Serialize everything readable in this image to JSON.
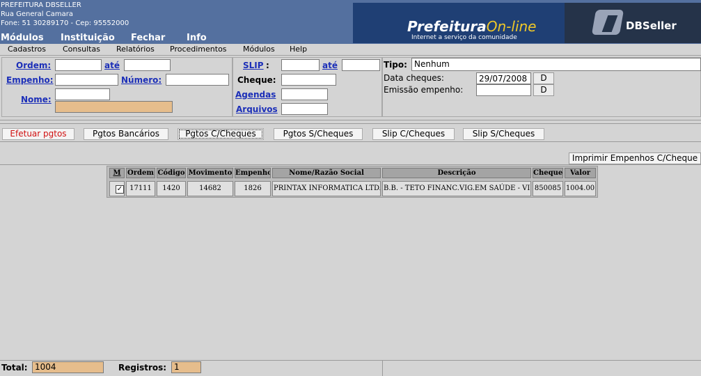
{
  "header": {
    "org_name": "PREFEITURA DBSELLER",
    "address": "Rua General Camara",
    "contact": "Fone: 51 30289170  -  Cep: 95552000",
    "top_menu": [
      "Módulos",
      "Instituição",
      "Fechar",
      "Info"
    ],
    "banner": {
      "logo_main": "Prefeitura",
      "logo_accent": "On-line",
      "tagline": "Internet a serviço da comunidade",
      "brand": "DBSeller"
    }
  },
  "menubar": [
    "Cadastros",
    "Consultas",
    "Relatórios",
    "Procedimentos",
    "Módulos",
    "Help"
  ],
  "filters": {
    "ordem_label": "Ordem:",
    "ate_label": "até",
    "empenho_label": "Empenho:",
    "numero_label": "Número:",
    "nome_label": "Nome:",
    "slip_label": "SLIP",
    "slip_colon": ":",
    "slip_ate_label": "até",
    "cheque_label": "Cheque:",
    "agendas_label": "Agendas",
    "arquivos_label": "Arquivos",
    "tipo_label": "Tipo:",
    "tipo_value": "Nenhum",
    "data_cheques_label": "Data cheques:",
    "data_cheques_value": "29/07/2008",
    "emissao_label": "Emissão empenho:",
    "d_button": "D"
  },
  "tabs": [
    "Efetuar pgtos",
    "Pgtos Bancários",
    "Pgtos C/Cheques",
    "Pgtos S/Cheques",
    "Slip C/Cheques",
    "Slip S/Cheques"
  ],
  "print_button": "Imprimir Empenhos C/Cheque",
  "table": {
    "headers": [
      "M",
      "Ordem",
      "Código",
      "Movimento",
      "Empenho",
      "Nome/Razão Social",
      "Descrição",
      "Cheque",
      "Valor"
    ],
    "rows": [
      {
        "checked": "✓",
        "ordem": "17111",
        "codigo": "1420",
        "movimento": "14682",
        "empenho": "1826",
        "nome": "PRINTAX INFORMATICA LTDA",
        "descricao": "B.B. - TETO FINANC.VIG.EM SAÚDE - VISA",
        "cheque": "850085",
        "valor": "1004.00"
      }
    ]
  },
  "footer": {
    "total_label": "Total:",
    "total_value": "1004",
    "registros_label": "Registros:",
    "registros_value": "1"
  },
  "colors": {
    "header_bg": "#54709f",
    "link": "#1c2fb8",
    "active_tab_text": "#d01010",
    "readonly_field": "#e6bd8c"
  }
}
